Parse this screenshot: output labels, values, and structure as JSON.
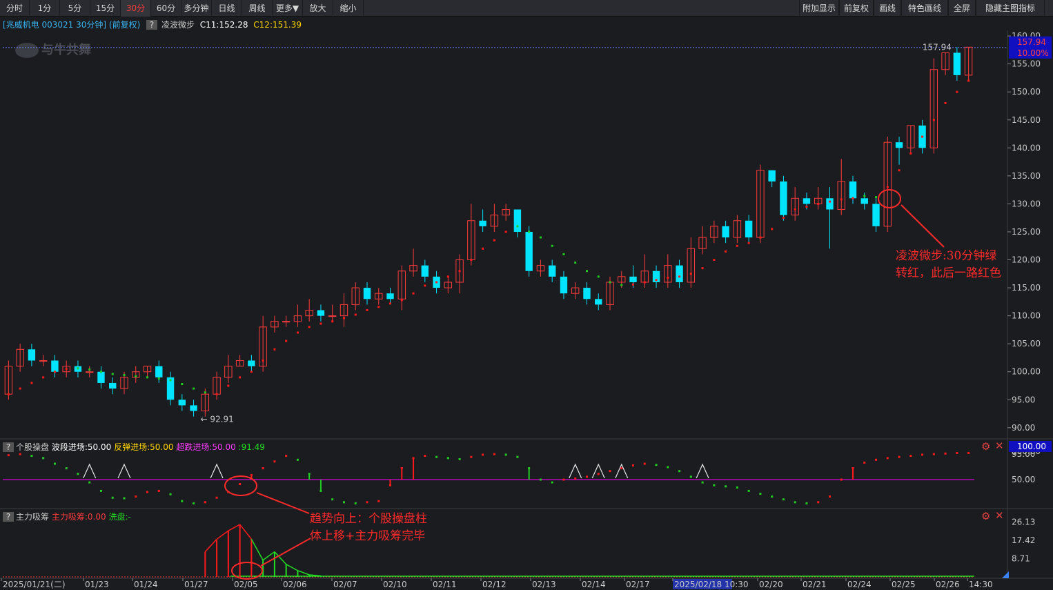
{
  "toolbar": {
    "left": [
      "分时",
      "1分",
      "5分",
      "15分",
      "30分",
      "60分",
      "多分钟",
      "日线",
      "周线",
      "更多▼",
      "放大",
      "缩小"
    ],
    "active_index": 4,
    "right": [
      "附加显示",
      "前复权",
      "画线",
      "特色画线",
      "全屏",
      "隐藏主图指标"
    ]
  },
  "watermark": "与牛共舞",
  "main_title": {
    "stock": "[兆威机电 003021 30分钟]",
    "adjust": "(前复权)",
    "q": "?",
    "indicator": "凌波微步",
    "c11": "C11:152.28",
    "c12": "C12:151.39"
  },
  "sub1_title": {
    "q": "?",
    "name": "个股操盘",
    "wave": "波段进场:50.00",
    "rebound": "反弹进场:50.00",
    "oversold": "超跌进场:50.00",
    "last": ":91.49"
  },
  "sub2_title": {
    "q": "?",
    "name": "主力吸筹",
    "absorb": "主力吸筹:0.00",
    "wash": "洗盘:",
    "wash_tail": "-"
  },
  "annotations": {
    "right_line1": "凌波微步:30分钟绿",
    "right_line2": "转红，此后一路红色",
    "bottom_line1": "趋势向上：个股操盘柱",
    "bottom_line2": "体上移+主力吸筹完毕"
  },
  "colors": {
    "up": "#ff3b3b",
    "down": "#00e5ff",
    "dot_red": "#ff1a1a",
    "dot_green": "#22cc22",
    "magenta": "#ff00ff",
    "price_box": "#1010c0"
  },
  "chart_data": [
    {
      "type": "candlestick",
      "title": "",
      "y_ticks": [
        160.0,
        155.0,
        150.0,
        145.0,
        140.0,
        135.0,
        130.0,
        125.0,
        120.0,
        115.0,
        110.0,
        105.0,
        100.0,
        95.0,
        90.0
      ],
      "ylim": [
        88.5,
        161
      ],
      "current_price": "157.94",
      "current_pct": "10.00%",
      "high_label": "157.94",
      "low_label": "92.91",
      "x_labels": [
        "2025/01/21(二)",
        "01/23",
        "01/24",
        "01/27",
        "02/05",
        "02/06",
        "02/07",
        "02/10",
        "02/11",
        "02/12",
        "02/13",
        "02/14",
        "02/17",
        "2025/02/18 10:30",
        "02/20",
        "02/21",
        "02/24",
        "02/25",
        "02/26",
        "14:30"
      ],
      "candles": [
        [
          96,
          101,
          95,
          102
        ],
        [
          101,
          104,
          100,
          105
        ],
        [
          104,
          102,
          101,
          105
        ],
        [
          102,
          102,
          101,
          103
        ],
        [
          102,
          100,
          99,
          103
        ],
        [
          100,
          101,
          99,
          102
        ],
        [
          101,
          100,
          99,
          102
        ],
        [
          100,
          100,
          99,
          101
        ],
        [
          100,
          98,
          97,
          101
        ],
        [
          98,
          97,
          96,
          99
        ],
        [
          97,
          99,
          96,
          100
        ],
        [
          99,
          100,
          98,
          101
        ],
        [
          100,
          101,
          99,
          101
        ],
        [
          101,
          99,
          98,
          102
        ],
        [
          99,
          95,
          94,
          100
        ],
        [
          95,
          94,
          93,
          96
        ],
        [
          94,
          93,
          92,
          95
        ],
        [
          93,
          96,
          92,
          97
        ],
        [
          96,
          99,
          95,
          100
        ],
        [
          99,
          101,
          98,
          103
        ],
        [
          101,
          102,
          101,
          103
        ],
        [
          102,
          101,
          100,
          103
        ],
        [
          101,
          108,
          100,
          110
        ],
        [
          108,
          109,
          107,
          110
        ],
        [
          109,
          109,
          108,
          110
        ],
        [
          109,
          110,
          108,
          112
        ],
        [
          110,
          111,
          109,
          113
        ],
        [
          111,
          110,
          109,
          112
        ],
        [
          110,
          110,
          109,
          112
        ],
        [
          110,
          112,
          108,
          114
        ],
        [
          112,
          115,
          111,
          116
        ],
        [
          115,
          113,
          112,
          116
        ],
        [
          113,
          114,
          112,
          115
        ],
        [
          114,
          113,
          112,
          115
        ],
        [
          113,
          118,
          111,
          119
        ],
        [
          118,
          119,
          117,
          122
        ],
        [
          119,
          117,
          116,
          120
        ],
        [
          117,
          115,
          114,
          118
        ],
        [
          115,
          116,
          114,
          117
        ],
        [
          116,
          120,
          114,
          121
        ],
        [
          120,
          127,
          119,
          130
        ],
        [
          127,
          126,
          125,
          129
        ],
        [
          126,
          128,
          125,
          130
        ],
        [
          128,
          129,
          127,
          130
        ],
        [
          129,
          125,
          124,
          126
        ],
        [
          125,
          118,
          117,
          126
        ],
        [
          118,
          119,
          117,
          120
        ],
        [
          119,
          117,
          116,
          120
        ],
        [
          117,
          114,
          113,
          118
        ],
        [
          114,
          115,
          113,
          116
        ],
        [
          115,
          113,
          112,
          116
        ],
        [
          113,
          112,
          111,
          114
        ],
        [
          112,
          116,
          111,
          117
        ],
        [
          116,
          117,
          115,
          118
        ],
        [
          117,
          116,
          115,
          119
        ],
        [
          116,
          118,
          115,
          121
        ],
        [
          118,
          116,
          115,
          119
        ],
        [
          116,
          119,
          115,
          121
        ],
        [
          119,
          116,
          115,
          120
        ],
        [
          116,
          122,
          115,
          124
        ],
        [
          122,
          124,
          121,
          126
        ],
        [
          124,
          126,
          123,
          127
        ],
        [
          126,
          124,
          123,
          127
        ],
        [
          124,
          127,
          123,
          128
        ],
        [
          127,
          124,
          123,
          128
        ],
        [
          124,
          136,
          123,
          137
        ],
        [
          136,
          134,
          133,
          136
        ],
        [
          134,
          128,
          127,
          135
        ],
        [
          128,
          131,
          127,
          133
        ],
        [
          131,
          130,
          129,
          132
        ],
        [
          130,
          131,
          129,
          133
        ],
        [
          131,
          129,
          122,
          133
        ],
        [
          129,
          134,
          128,
          138
        ],
        [
          134,
          131,
          130,
          135
        ],
        [
          131,
          130,
          129,
          132
        ],
        [
          130,
          126,
          125,
          131
        ],
        [
          126,
          141,
          125,
          142
        ],
        [
          141,
          140,
          137,
          142
        ],
        [
          140,
          144,
          139,
          144
        ],
        [
          144,
          140,
          139,
          145
        ],
        [
          140,
          154,
          139,
          156
        ],
        [
          154,
          157,
          153,
          157
        ],
        [
          157,
          153,
          152,
          158
        ],
        [
          153,
          158,
          152,
          158
        ]
      ],
      "dots": [
        [
          96,
          "r"
        ],
        [
          97,
          "r"
        ],
        [
          98,
          "r"
        ],
        [
          99,
          "r"
        ],
        [
          100,
          "r"
        ],
        [
          100.5,
          "r"
        ],
        [
          100.6,
          "g"
        ],
        [
          100.4,
          "g"
        ],
        [
          100,
          "g"
        ],
        [
          99.6,
          "g"
        ],
        [
          99.4,
          "g"
        ],
        [
          99.2,
          "g"
        ],
        [
          99,
          "g"
        ],
        [
          98.8,
          "g"
        ],
        [
          98.5,
          "g"
        ],
        [
          97.8,
          "g"
        ],
        [
          97,
          "g"
        ],
        [
          96.3,
          "g"
        ],
        [
          96,
          "r"
        ],
        [
          97.5,
          "r"
        ],
        [
          99,
          "r"
        ],
        [
          100,
          "r"
        ],
        [
          102,
          "r"
        ],
        [
          104,
          "r"
        ],
        [
          105.5,
          "r"
        ],
        [
          107,
          "r"
        ],
        [
          108,
          "r"
        ],
        [
          108.6,
          "r"
        ],
        [
          109,
          "r"
        ],
        [
          109.6,
          "r"
        ],
        [
          110.2,
          "r"
        ],
        [
          111,
          "r"
        ],
        [
          111.6,
          "r"
        ],
        [
          112.2,
          "r"
        ],
        [
          112.8,
          "r"
        ],
        [
          114,
          "r"
        ],
        [
          115.4,
          "r"
        ],
        [
          116,
          "r"
        ],
        [
          117,
          "r"
        ],
        [
          118,
          "r"
        ],
        [
          120,
          "r"
        ],
        [
          122,
          "r"
        ],
        [
          123.5,
          "r"
        ],
        [
          125,
          "r"
        ],
        [
          126,
          "g"
        ],
        [
          125,
          "g"
        ],
        [
          124,
          "g"
        ],
        [
          122.5,
          "g"
        ],
        [
          121,
          "g"
        ],
        [
          119.5,
          "g"
        ],
        [
          118,
          "g"
        ],
        [
          117,
          "g"
        ],
        [
          116,
          "g"
        ],
        [
          115.5,
          "g"
        ],
        [
          115.6,
          "r"
        ],
        [
          116,
          "r"
        ],
        [
          116.4,
          "r"
        ],
        [
          116.8,
          "r"
        ],
        [
          117,
          "r"
        ],
        [
          117.5,
          "r"
        ],
        [
          118.5,
          "r"
        ],
        [
          120,
          "r"
        ],
        [
          121.5,
          "r"
        ],
        [
          122.5,
          "r"
        ],
        [
          123,
          "r"
        ],
        [
          124,
          "r"
        ],
        [
          125.5,
          "r"
        ],
        [
          127.5,
          "r"
        ],
        [
          129,
          "r"
        ],
        [
          129.5,
          "r"
        ],
        [
          130,
          "r"
        ],
        [
          130.4,
          "r"
        ],
        [
          130.8,
          "r"
        ],
        [
          131,
          "r"
        ],
        [
          131.4,
          "g"
        ],
        [
          131.2,
          "g"
        ],
        [
          133,
          "r"
        ],
        [
          136,
          "r"
        ],
        [
          139,
          "r"
        ],
        [
          142,
          "r"
        ],
        [
          145,
          "r"
        ],
        [
          148,
          "r"
        ],
        [
          150,
          "r"
        ],
        [
          152,
          "r"
        ]
      ]
    },
    {
      "type": "line",
      "title": "",
      "y_ticks": [
        100.0,
        95.0,
        50.0
      ],
      "ylim": [
        0,
        100
      ],
      "current_label": "100.00",
      "series": [
        {
          "values": [
            93,
            95,
            92,
            88,
            78,
            70,
            60,
            45,
            30,
            18,
            17,
            20,
            28,
            30,
            24,
            12,
            8,
            10,
            18,
            28,
            42,
            58,
            70,
            82,
            92,
            85,
            60,
            30,
            15,
            10,
            8,
            10,
            12,
            40,
            70,
            88,
            92,
            90,
            88,
            86,
            90,
            94,
            95,
            94,
            90,
            70,
            50,
            45,
            50,
            52,
            55,
            60,
            65,
            70,
            75,
            78,
            76,
            72,
            65,
            55,
            45,
            40,
            38,
            36,
            30,
            25,
            20,
            15,
            10,
            8,
            10,
            20,
            50,
            70,
            80,
            85,
            88,
            90,
            92,
            94,
            95,
            96,
            97,
            97
          ]
        }
      ],
      "triangle_bars": [
        7,
        10,
        18,
        49,
        51,
        53,
        60
      ]
    },
    {
      "type": "area",
      "title": "",
      "y_ticks": [
        26.13,
        17.42,
        8.71
      ],
      "ylim": [
        0,
        27
      ],
      "series": [
        {
          "values": [
            0,
            0,
            0,
            0,
            0,
            0,
            0,
            0,
            0,
            0,
            0,
            0,
            0,
            0,
            0,
            0,
            0,
            12,
            18,
            22,
            25,
            18,
            8,
            12,
            6,
            3,
            1,
            0.5,
            0,
            0,
            0,
            0,
            0,
            0,
            0,
            0,
            0,
            0,
            0,
            0,
            0,
            0,
            0,
            0,
            0,
            0,
            0,
            0,
            0,
            0,
            0,
            0,
            0,
            0,
            0,
            0,
            0,
            0,
            0,
            0,
            0,
            0,
            0,
            0,
            0,
            0,
            0,
            0,
            0,
            0,
            0,
            0,
            0,
            0,
            0,
            0,
            0,
            0,
            0,
            0,
            0,
            0,
            0,
            0
          ]
        }
      ]
    }
  ]
}
